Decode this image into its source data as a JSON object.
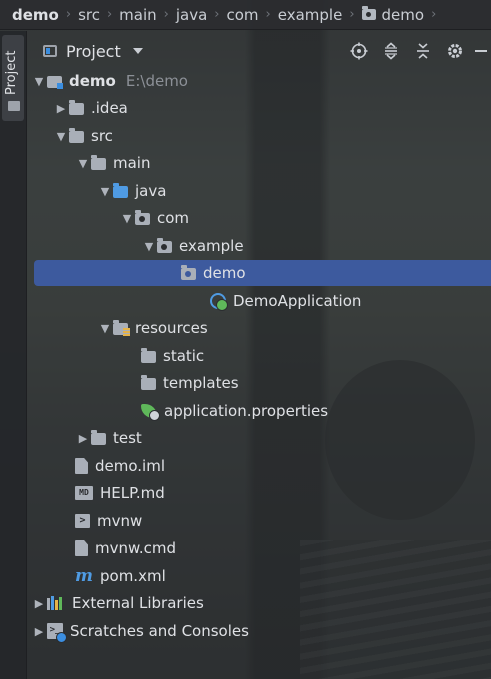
{
  "breadcrumb": [
    "demo",
    "src",
    "main",
    "java",
    "com",
    "example",
    "demo"
  ],
  "toolstrip": {
    "project_tab_label": "Project"
  },
  "panel": {
    "title": "Project",
    "actions": [
      "locate-icon",
      "expand-all-icon",
      "collapse-all-icon",
      "gear-icon",
      "minimize-icon"
    ]
  },
  "tree": {
    "root": {
      "label": "demo",
      "path": "E:\\demo"
    },
    "idea": ".idea",
    "src": "src",
    "main": "main",
    "java": "java",
    "com": "com",
    "example": "example",
    "demo_pkg": "demo",
    "demo_app": "DemoApplication",
    "resources": "resources",
    "static": "static",
    "templates": "templates",
    "app_props": "application.properties",
    "test": "test",
    "demo_iml": "demo.iml",
    "help_md": "HELP.md",
    "mvnw": "mvnw",
    "mvnw_cmd": "mvnw.cmd",
    "pom": "pom.xml",
    "external_libraries": "External Libraries",
    "scratches": "Scratches and Consoles"
  },
  "colors": {
    "selection": "#3d5a9e",
    "folder_blue": "#4f9be3",
    "spring_green": "#5fb85a"
  }
}
